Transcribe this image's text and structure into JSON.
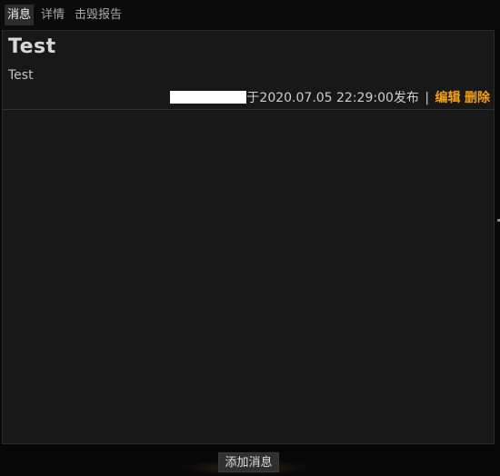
{
  "tabs": [
    {
      "label": "消息",
      "active": true
    },
    {
      "label": "详情",
      "active": false
    },
    {
      "label": "击毁报告",
      "active": false
    }
  ],
  "message": {
    "title": "Test",
    "body": "Test",
    "meta": "于2020.07.05 22:29:00发布",
    "separator": "|",
    "edit_label": "编辑",
    "delete_label": "删除"
  },
  "footer": {
    "add_label": "添加消息"
  },
  "colors": {
    "accent": "#f0a010",
    "background": "#070707",
    "panel": "#181818"
  }
}
